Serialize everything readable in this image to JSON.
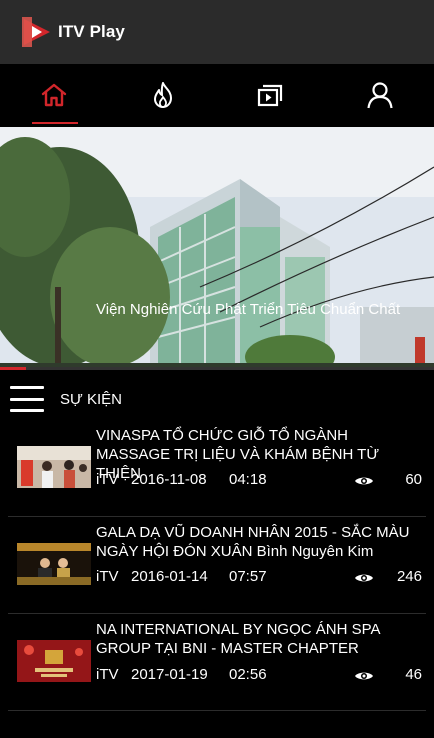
{
  "app": {
    "title": "ITV Play",
    "logo_icon": "play-logo-icon",
    "colors": {
      "accent": "#d2262b",
      "app_bar": "#2b2b2b",
      "background": "#000000"
    }
  },
  "tabs": [
    {
      "name": "home",
      "icon": "home-icon",
      "active": true
    },
    {
      "name": "hot",
      "icon": "fire-icon",
      "active": false
    },
    {
      "name": "videos",
      "icon": "video-library-icon",
      "active": false
    },
    {
      "name": "account",
      "icon": "user-icon",
      "active": false
    }
  ],
  "banner": {
    "progress": 0.06
  },
  "section": {
    "title": "SỰ KIỆN",
    "menu_icon": "hamburger-menu-icon"
  },
  "videos": [
    {
      "title": "VINASPA TỔ CHỨC GIỖ TỔ NGÀNH MASSAGE TRỊ LIỆU VÀ KHÁM BỆNH TỪ THIỆN",
      "channel": "iTV",
      "date": "2016-11-08",
      "time": "04:18",
      "views": "60"
    },
    {
      "title": "GALA DẠ VŨ DOANH NHÂN 2015 - SẮC MÀU NGÀY HỘI ĐÓN XUÂN Bình Nguyên Kim",
      "channel": "iTV",
      "date": "2016-01-14",
      "time": "07:57",
      "views": "246"
    },
    {
      "title": "NA INTERNATIONAL BY NGỌC ÁNH SPA GROUP TẠI BNI - MASTER CHAPTER",
      "channel": "iTV",
      "date": "2017-01-19",
      "time": "02:56",
      "views": "46"
    },
    {
      "title": "Viện Nghiên Cứu Phát Triển Tiêu Chuẩn Chất"
    }
  ]
}
